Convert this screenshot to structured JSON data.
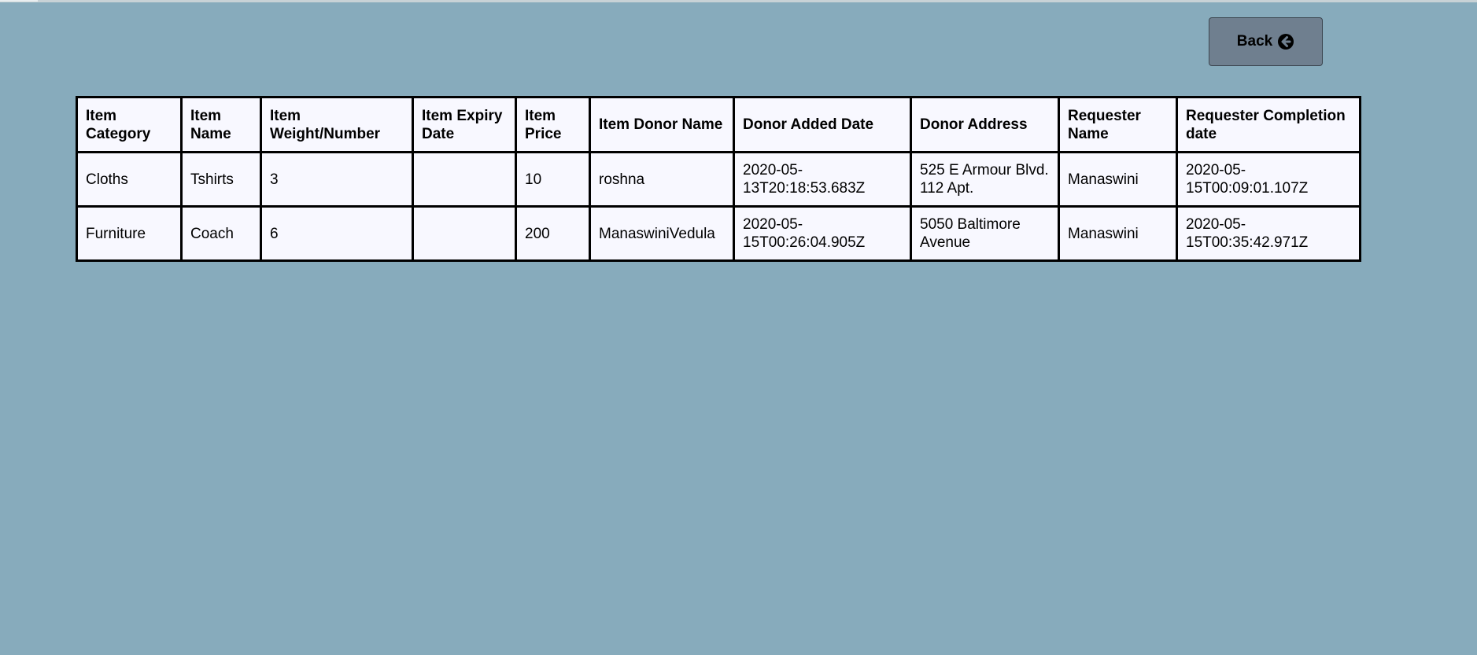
{
  "back_button": {
    "label": "Back"
  },
  "icons": {
    "back": "circle-arrow-left-icon"
  },
  "table": {
    "headers": [
      "Item Category",
      "Item Name",
      "Item Weight/Number",
      "Item Expiry Date",
      "Item Price",
      "Item Donor Name",
      "Donor Added Date",
      "Donor Address",
      "Requester Name",
      "Requester Completion date"
    ],
    "rows": [
      {
        "category": "Cloths",
        "name": "Tshirts",
        "weight": "3",
        "expiry": "",
        "price": "10",
        "donor_name": "roshna",
        "donor_added_date": "2020-05-13T20:18:53.683Z",
        "donor_address": "525 E Armour Blvd. 112 Apt.",
        "requester_name": "Manaswini",
        "completion_date": "2020-05-15T00:09:01.107Z"
      },
      {
        "category": "Furniture",
        "name": "Coach",
        "weight": "6",
        "expiry": "",
        "price": "200",
        "donor_name": "ManaswiniVedula",
        "donor_added_date": "2020-05-15T00:26:04.905Z",
        "donor_address": "5050 Baltimore Avenue",
        "requester_name": "Manaswini",
        "completion_date": "2020-05-15T00:35:42.971Z"
      }
    ]
  },
  "colors": {
    "page_background": "#87abbc",
    "button_background": "#6f7f8f",
    "table_background": "#f8f8ff"
  }
}
